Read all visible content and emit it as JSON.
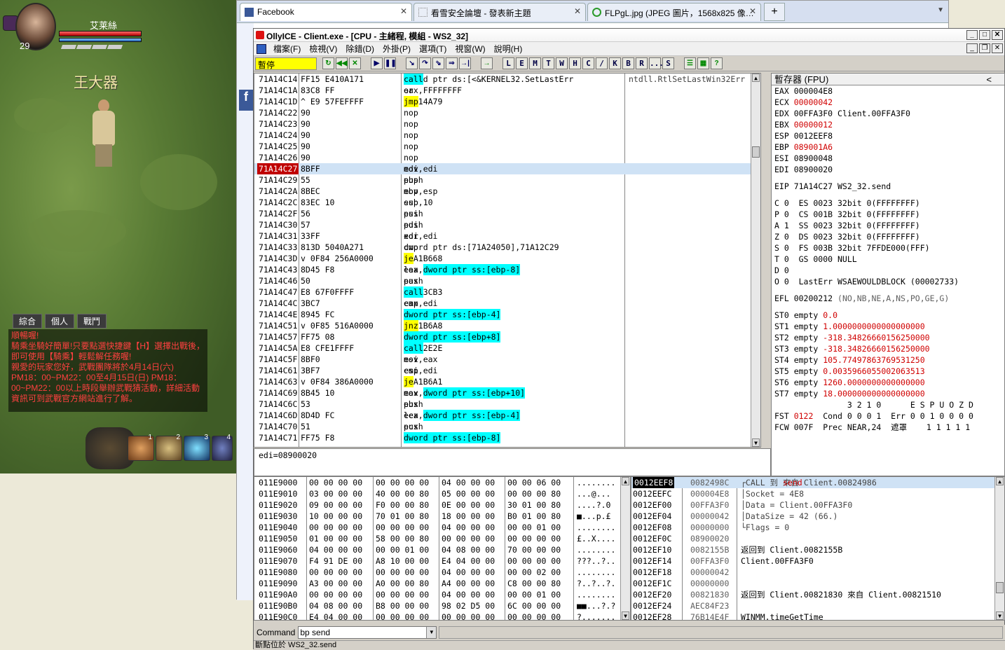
{
  "game": {
    "player_name": "艾莱絲",
    "level": "29",
    "npc_name": "王大器",
    "chat_tabs": [
      "綜合",
      "個人",
      "戰鬥"
    ],
    "chat_lines": [
      {
        "text": "順暢喔!",
        "color": "red"
      },
      {
        "text": "騎乘坐騎好簡單!只要點選快捷鍵【H】選擇出戰後，即可使用【騎乘】輕鬆解任務喔!",
        "color": "red"
      },
      {
        "text": "親愛的玩家您好，武戰團隊將於4月14日(六) PM18：00~PM22：00至4月15日(日) PM18：00~PM22：00以上時段舉辦武戰猜活動，詳細活動資訊可到武戰官方網站進行了解。",
        "color": "red"
      }
    ],
    "skill_numbers": [
      "1",
      "2",
      "3",
      "4"
    ]
  },
  "browser": {
    "tabs": [
      {
        "label": "Facebook",
        "active": true
      },
      {
        "label": "看雪安全論壇 - 發表新主題",
        "active": false
      },
      {
        "label": "FLPgL.jpg (JPEG 圖片，1568x825 像…",
        "active": false
      }
    ],
    "new_tab": "+",
    "side_logo": "f"
  },
  "olly": {
    "title": "OllyICE - Client.exe - [CPU - 主緒程, 模組 - WS2_32]",
    "menu": [
      "檔案(F)",
      "檢視(V)",
      "除錯(D)",
      "外掛(P)",
      "選項(T)",
      "視窗(W)",
      "說明(H)"
    ],
    "status": "暫停",
    "toolbar_letters": [
      "L",
      "E",
      "M",
      "T",
      "W",
      "H",
      "C",
      "/",
      "K",
      "B",
      "R",
      "...",
      "S"
    ],
    "cpu_rows": [
      {
        "addr": "71A14C14",
        "hex": "FF15 E410A171",
        "op": "call",
        "arg": "dword ptr ds:[<&KERNEL32.SetLastErr",
        "cmt": "ntdll.RtlSetLastWin32Err",
        "kw": "call"
      },
      {
        "addr": "71A14C1A",
        "hex": "83C8 FF",
        "op": "or",
        "arg": "eax,FFFFFFFF",
        "cmt": "",
        "kw": ""
      },
      {
        "addr": "71A14C1D",
        "hex": "^ E9 57FEFFFF",
        "op": "jmp",
        "arg": "71A14A79",
        "cmt": "",
        "kw": "jmp"
      },
      {
        "addr": "71A14C22",
        "hex": "90",
        "op": "nop",
        "arg": "",
        "cmt": "",
        "kw": ""
      },
      {
        "addr": "71A14C23",
        "hex": "90",
        "op": "nop",
        "arg": "",
        "cmt": "",
        "kw": ""
      },
      {
        "addr": "71A14C24",
        "hex": "90",
        "op": "nop",
        "arg": "",
        "cmt": "",
        "kw": ""
      },
      {
        "addr": "71A14C25",
        "hex": "90",
        "op": "nop",
        "arg": "",
        "cmt": "",
        "kw": ""
      },
      {
        "addr": "71A14C26",
        "hex": "90",
        "op": "nop",
        "arg": "",
        "cmt": "",
        "kw": ""
      },
      {
        "addr": "71A14C27",
        "hex": "8BFF",
        "op": "mov",
        "arg": "edi,edi",
        "cmt": "",
        "kw": "",
        "eip": true
      },
      {
        "addr": "71A14C29",
        "hex": "55",
        "op": "push",
        "arg": "ebp",
        "cmt": "",
        "kw": ""
      },
      {
        "addr": "71A14C2A",
        "hex": "8BEC",
        "op": "mov",
        "arg": "ebp,esp",
        "cmt": "",
        "kw": ""
      },
      {
        "addr": "71A14C2C",
        "hex": "83EC 10",
        "op": "sub",
        "arg": "esp,10",
        "cmt": "",
        "kw": ""
      },
      {
        "addr": "71A14C2F",
        "hex": "56",
        "op": "push",
        "arg": "esi",
        "cmt": "",
        "kw": ""
      },
      {
        "addr": "71A14C30",
        "hex": "57",
        "op": "push",
        "arg": "edi",
        "cmt": "",
        "kw": ""
      },
      {
        "addr": "71A14C31",
        "hex": "33FF",
        "op": "xor",
        "arg": "edi,edi",
        "cmt": "",
        "kw": ""
      },
      {
        "addr": "71A14C33",
        "hex": "813D 5040A271",
        "op": "cmp",
        "arg": "dword ptr ds:[71A24050],71A12C29",
        "cmt": "",
        "kw": ""
      },
      {
        "addr": "71A14C3D",
        "hex": "v 0F84 256A0000",
        "op": "je",
        "arg": "71A1B668",
        "cmt": "",
        "kw": "je"
      },
      {
        "addr": "71A14C43",
        "hex": "8D45 F8",
        "op": "lea",
        "arg": "eax,",
        "hl": "dword ptr ss:[ebp-8]",
        "cmt": "",
        "kw": ""
      },
      {
        "addr": "71A14C46",
        "hex": "50",
        "op": "push",
        "arg": "eax",
        "cmt": "",
        "kw": ""
      },
      {
        "addr": "71A14C47",
        "hex": "E8 67F0FFFF",
        "op": "call",
        "arg": "71A13CB3",
        "cmt": "",
        "kw": "call"
      },
      {
        "addr": "71A14C4C",
        "hex": "3BC7",
        "op": "cmp",
        "arg": "eax,edi",
        "cmt": "",
        "kw": ""
      },
      {
        "addr": "71A14C4E",
        "hex": "8945 FC",
        "op": "mov",
        "arg": "",
        "hl": "dword ptr ss:[ebp-4]",
        "tail": ",eax",
        "cmt": "",
        "kw": ""
      },
      {
        "addr": "71A14C51",
        "hex": "v 0F85 516A0000",
        "op": "jnz",
        "arg": "71A1B6A8",
        "cmt": "",
        "kw": "jnz"
      },
      {
        "addr": "71A14C57",
        "hex": "FF75 08",
        "op": "push",
        "arg": "",
        "hl": "dword ptr ss:[ebp+8]",
        "cmt": "",
        "kw": ""
      },
      {
        "addr": "71A14C5A",
        "hex": "E8 CFE1FFFF",
        "op": "call",
        "arg": "71A12E2E",
        "cmt": "",
        "kw": "call"
      },
      {
        "addr": "71A14C5F",
        "hex": "8BF0",
        "op": "mov",
        "arg": "esi,eax",
        "cmt": "",
        "kw": ""
      },
      {
        "addr": "71A14C61",
        "hex": "3BF7",
        "op": "cmp",
        "arg": "esi,edi",
        "cmt": "",
        "kw": ""
      },
      {
        "addr": "71A14C63",
        "hex": "v 0F84 386A0000",
        "op": "je",
        "arg": "71A1B6A1",
        "cmt": "",
        "kw": "je"
      },
      {
        "addr": "71A14C69",
        "hex": "8B45 10",
        "op": "mov",
        "arg": "eax,",
        "hl": "dword ptr ss:[ebp+10]",
        "cmt": "",
        "kw": ""
      },
      {
        "addr": "71A14C6C",
        "hex": "53",
        "op": "push",
        "arg": "ebx",
        "cmt": "",
        "kw": ""
      },
      {
        "addr": "71A14C6D",
        "hex": "8D4D FC",
        "op": "lea",
        "arg": "ecx,",
        "hl": "dword ptr ss:[ebp-4]",
        "cmt": "",
        "kw": ""
      },
      {
        "addr": "71A14C70",
        "hex": "51",
        "op": "push",
        "arg": "ecx",
        "cmt": "",
        "kw": ""
      },
      {
        "addr": "71A14C71",
        "hex": "FF75 F8",
        "op": "push",
        "arg": "",
        "hl": "dword ptr ss:[ebp-8]",
        "cmt": "",
        "kw": ""
      }
    ],
    "info_line": "edi=08900020",
    "regs_header": "暫存器 (FPU)",
    "regs_collapse": "<",
    "registers": [
      {
        "name": "EAX",
        "value": "000004E8",
        "extra": "",
        "changed": false
      },
      {
        "name": "ECX",
        "value": "00000042",
        "extra": "",
        "changed": true
      },
      {
        "name": "EDX",
        "value": "00FFA3F0",
        "extra": "Client.00FFA3F0",
        "changed": false
      },
      {
        "name": "EBX",
        "value": "00000012",
        "extra": "",
        "changed": true
      },
      {
        "name": "ESP",
        "value": "0012EEF8",
        "extra": "",
        "changed": false
      },
      {
        "name": "EBP",
        "value": "089001A6",
        "extra": "",
        "changed": true
      },
      {
        "name": "ESI",
        "value": "08900048",
        "extra": "",
        "changed": false
      },
      {
        "name": "EDI",
        "value": "08900020",
        "extra": "",
        "changed": false
      }
    ],
    "eip_line": "EIP 71A14C27 WS2_32.send",
    "flags": [
      "C 0  ES 0023 32bit 0(FFFFFFFF)",
      "P 0  CS 001B 32bit 0(FFFFFFFF)",
      "A 1  SS 0023 32bit 0(FFFFFFFF)",
      "Z 0  DS 0023 32bit 0(FFFFFFFF)",
      "S 0  FS 003B 32bit 7FFDE000(FFF)",
      "T 0  GS 0000 NULL",
      "D 0",
      "O 0  LastErr WSAEWOULDBLOCK (00002733)"
    ],
    "efl_label": "EFL 00200212",
    "efl_desc": "(NO,NB,NE,A,NS,PO,GE,G)",
    "fpu": [
      {
        "name": "ST0",
        "state": "empty",
        "value": "0.0"
      },
      {
        "name": "ST1",
        "state": "empty",
        "value": "1.0000000000000000000"
      },
      {
        "name": "ST2",
        "state": "empty",
        "value": "-318.34826660156250000"
      },
      {
        "name": "ST3",
        "state": "empty",
        "value": "-318.34826660156250000"
      },
      {
        "name": "ST4",
        "state": "empty",
        "value": "105.77497863769531250"
      },
      {
        "name": "ST5",
        "state": "empty",
        "value": "0.0035966055002063513"
      },
      {
        "name": "ST6",
        "state": "empty",
        "value": "1260.0000000000000000"
      },
      {
        "name": "ST7",
        "state": "empty",
        "value": "18.000000000000000000"
      }
    ],
    "fpu_bits_header": "               3 2 1 0      E S P U O Z D",
    "fst_line": {
      "prefix": "FST ",
      "value": "0122",
      "rest": "  Cond 0 0 0 1  Err 0 0 1 0 0 0 0"
    },
    "fcw_line": {
      "prefix": "FCW 007F  Prec NEAR,24  ",
      "mask": "遮罩",
      "rest": "    1 1 1 1 1"
    },
    "dump_rows": [
      {
        "addr": "011E9000",
        "hex": "00 00 00 00 00 00 00 00 04 00 00 00 00 00 06 00",
        "ascii": "........"
      },
      {
        "addr": "011E9010",
        "hex": "03 00 00 00 40 00 00 80 05 00 00 00 00 00 00 80",
        "ascii": "...@..."
      },
      {
        "addr": "011E9020",
        "hex": "09 00 00 00 F0 00 00 80 0E 00 00 00 30 01 00 80",
        "ascii": "....?.0"
      },
      {
        "addr": "011E9030",
        "hex": "10 00 00 00 70 01 00 80 18 00 00 00 B0 01 00 80",
        "ascii": "■...p.£"
      },
      {
        "addr": "011E9040",
        "hex": "00 00 00 00 00 00 00 00 04 00 00 00 00 00 01 00",
        "ascii": "........"
      },
      {
        "addr": "011E9050",
        "hex": "01 00 00 00 58 00 00 80 00 00 00 00 00 00 00 00",
        "ascii": "£..X...."
      },
      {
        "addr": "011E9060",
        "hex": "04 00 00 00 00 00 01 00 04 08 00 00 70 00 00 00",
        "ascii": "........"
      },
      {
        "addr": "011E9070",
        "hex": "F4 91 DE 00 A8 10 00 00 E4 04 00 00 00 00 00 00",
        "ascii": "???..?.."
      },
      {
        "addr": "011E9080",
        "hex": "00 00 00 00 00 00 00 00 04 00 00 00 00 00 02 00",
        "ascii": "........"
      },
      {
        "addr": "011E9090",
        "hex": "A3 00 00 00 A0 00 00 80 A4 00 00 00 C8 00 00 80",
        "ascii": "?..?..?."
      },
      {
        "addr": "011E90A0",
        "hex": "00 00 00 00 00 00 00 00 04 00 00 00 00 00 01 00",
        "ascii": "........"
      },
      {
        "addr": "011E90B0",
        "hex": "04 08 00 00 B8 00 00 00 98 02 D5 00 6C 00 00 00",
        "ascii": "■■...?.?"
      },
      {
        "addr": "011E90C0",
        "hex": "E4 04 00 00 00 00 00 00 00 00 00 00 00 00 00 00",
        "ascii": "?......."
      }
    ],
    "stack_rows": [
      {
        "addr": "0012EEF8",
        "val": "0082498C",
        "cmt": "CALL 到 ",
        "cmt_red": "send",
        "cmt_tail": " 來自 Client.00824986",
        "sel": true
      },
      {
        "addr": "0012EEFC",
        "val": "000004E8",
        "cmt": "Socket = 4E8"
      },
      {
        "addr": "0012EF00",
        "val": "00FFA3F0",
        "cmt": "Data = Client.00FFA3F0"
      },
      {
        "addr": "0012EF04",
        "val": "00000042",
        "cmt": "DataSize = 42 (66.)"
      },
      {
        "addr": "0012EF08",
        "val": "00000000",
        "cmt": "Flags = 0"
      },
      {
        "addr": "0012EF0C",
        "val": "08900020",
        "cmt": ""
      },
      {
        "addr": "0012EF10",
        "val": "0082155B",
        "cmt": "返回到 Client.0082155B"
      },
      {
        "addr": "0012EF14",
        "val": "00FFA3F0",
        "cmt": "Client.00FFA3F0"
      },
      {
        "addr": "0012EF18",
        "val": "00000042",
        "cmt": ""
      },
      {
        "addr": "0012EF1C",
        "val": "00000000",
        "cmt": ""
      },
      {
        "addr": "0012EF20",
        "val": "00821830",
        "cmt": "返回到 Client.00821830 來自 Client.00821510"
      },
      {
        "addr": "0012EF24",
        "val": "AEC84F23",
        "cmt": ""
      },
      {
        "addr": "0012EF28",
        "val": "76B14E4F",
        "cmt": "WINMM.timeGetTime"
      }
    ],
    "command_label": "Command",
    "command_value": "bp send",
    "status_text": "斷點位於 WS2_32.send"
  },
  "colors": {
    "red": "#d00000",
    "cyan": "#00ffff",
    "yellow": "#ffff00"
  }
}
